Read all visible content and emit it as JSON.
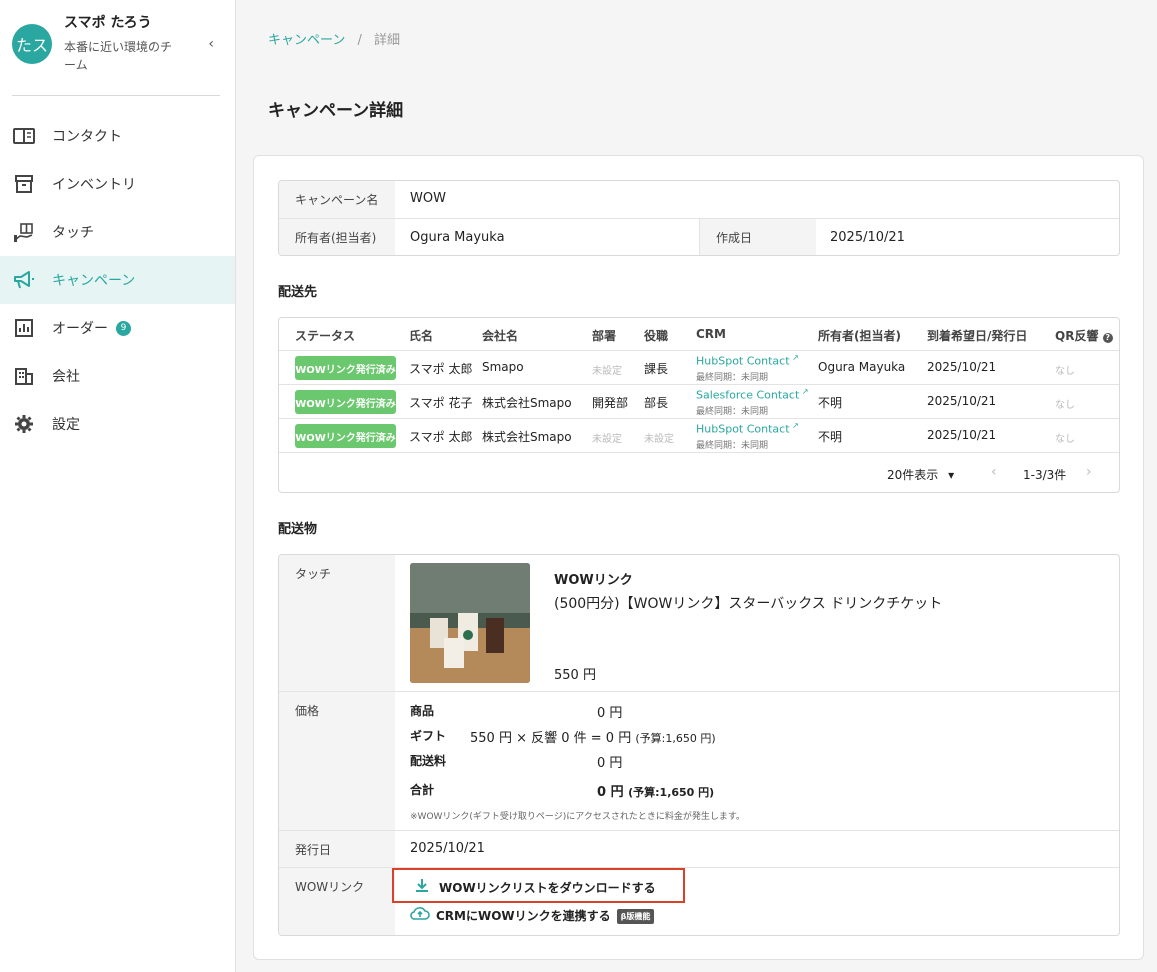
{
  "user": {
    "initials": "たス",
    "name": "スマポ たろう",
    "team": "本番に近い環境のチーム"
  },
  "nav": [
    {
      "label": "コンタクト",
      "icon": "contact-book-icon"
    },
    {
      "label": "インベントリ",
      "icon": "inventory-box-icon"
    },
    {
      "label": "タッチ",
      "icon": "gift-hand-icon"
    },
    {
      "label": "キャンペーン",
      "icon": "megaphone-icon",
      "active": true
    },
    {
      "label": "オーダー",
      "icon": "bar-chart-icon",
      "badge": "9"
    },
    {
      "label": "会社",
      "icon": "building-icon"
    },
    {
      "label": "設定",
      "icon": "gear-icon"
    }
  ],
  "breadcrumb": {
    "parent": "キャンペーン",
    "separator": "/",
    "current": "詳細"
  },
  "page_title": "キャンペーン詳細",
  "summary": {
    "campaign_name_label": "キャンペーン名",
    "campaign_name": "WOW",
    "owner_label": "所有者(担当者)",
    "owner": "Ogura Mayuka",
    "created_label": "作成日",
    "created": "2025/10/21"
  },
  "recipients": {
    "title": "配送先",
    "columns": [
      "ステータス",
      "氏名",
      "会社名",
      "部署",
      "役職",
      "CRM",
      "所有者(担当者)",
      "到着希望日/発行日",
      "QR反響"
    ],
    "rows": [
      {
        "status": "WOWリンク発行済み",
        "name": "スマポ 太郎",
        "company": "Smapo",
        "dept": "未設定",
        "title": "課長",
        "crm": "HubSpot Contact",
        "sync": "最終同期：未同期",
        "owner": "Ogura Mayuka",
        "date": "2025/10/21",
        "qr": "なし"
      },
      {
        "status": "WOWリンク発行済み",
        "name": "スマポ 花子",
        "company": "株式会社Smapo",
        "dept": "開発部",
        "title": "部長",
        "crm": "Salesforce Contact",
        "sync": "最終同期：未同期",
        "owner": "不明",
        "date": "2025/10/21",
        "qr": "なし"
      },
      {
        "status": "WOWリンク発行済み",
        "name": "スマポ 太郎",
        "company": "株式会社Smapo",
        "dept": "未設定",
        "title": "未設定",
        "crm": "HubSpot Contact",
        "sync": "最終同期：未同期",
        "owner": "不明",
        "date": "2025/10/21",
        "qr": "なし"
      }
    ],
    "per_page": "20件表示",
    "range": "1-3/3件"
  },
  "delivery": {
    "title": "配送物",
    "touch_label": "タッチ",
    "touch_type": "WOWリンク",
    "product_name": "(500円分)【WOWリンク】スターバックス ドリンクチケット",
    "product_price": "550 円",
    "price_label": "価格",
    "item_label": "商品",
    "item_value": "0 円",
    "gift_label": "ギフト",
    "gift_value": "550 円 × 反響 0 件 = 0 円",
    "gift_budget": "(予算:1,650 円)",
    "shipping_label": "配送料",
    "shipping_value": "0 円",
    "total_label": "合計",
    "total_value": "0 円",
    "total_budget": "(予算:1,650 円)",
    "note": "※WOWリンク(ギフト受け取りページ)にアクセスされたときに料金が発生します。",
    "issue_label": "発行日",
    "issue_date": "2025/10/21",
    "wow_label": "WOWリンク",
    "download_link": "WOWリンクリストをダウンロードする",
    "crm_link": "CRMにWOWリンクを連携する",
    "beta": "β版機能"
  },
  "colors": {
    "accent": "#2aa7a0",
    "status_green": "#6cc86f",
    "highlight": "#d9412b"
  }
}
